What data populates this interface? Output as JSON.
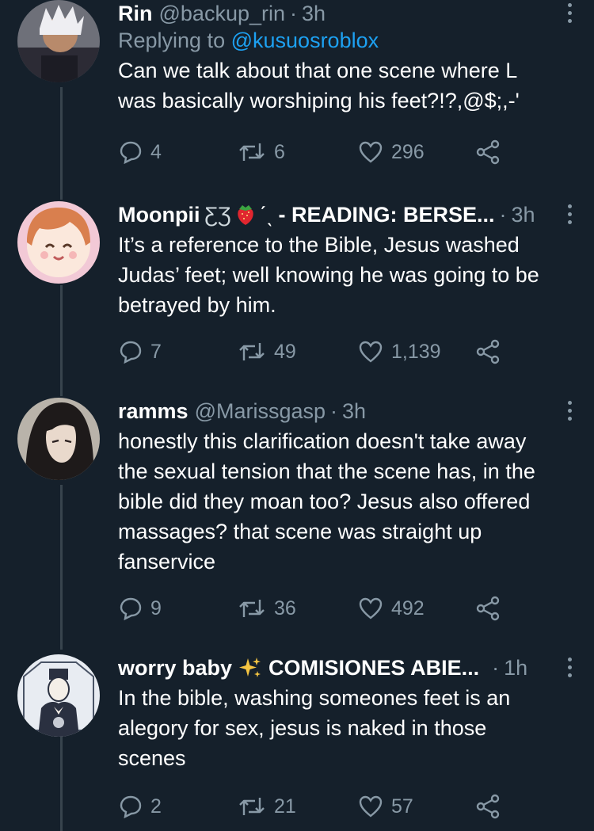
{
  "tweets": [
    {
      "name": "Rin",
      "handle": "@backup_rin",
      "time": "3h",
      "replying_label": "Replying to",
      "replying_to": "@kusuosroblox",
      "text": "Can we talk about that one scene where L\nwas basically worshiping his feet?!?,@$;,-'",
      "replies": "4",
      "retweets": "6",
      "likes": "296"
    },
    {
      "name": "Moonpii",
      "name_suffix": "- READING: BERSE...",
      "time": "3h",
      "text": "It’s a reference to the Bible, Jesus washed\nJudas’ feet; well knowing he was going to be\nbetrayed by him.",
      "replies": "7",
      "retweets": "49",
      "likes": "1,139"
    },
    {
      "name": "ramms",
      "handle": "@Marissgasp",
      "time": "3h",
      "text": "honestly this clarification doesn't take away\nthe sexual tension that the scene has, in the\nbible did they moan too? Jesus also offered\nmassages? that scene was straight up\nfanservice",
      "replies": "9",
      "retweets": "36",
      "likes": "492"
    },
    {
      "name": "worry baby",
      "name_suffix": "COMISIONES ABIE...",
      "time": "1h",
      "text": "In the bible, washing someones feet is an\nalegory for sex, jesus is naked in those\nscenes",
      "replies": "2",
      "retweets": "21",
      "likes": "57"
    }
  ],
  "icons": {
    "reply": "reply-icon",
    "retweet": "retweet-icon",
    "like": "heart-icon",
    "share": "share-icon",
    "more": "more-vertical-icon"
  },
  "colors": {
    "background": "#15202b",
    "text": "#ffffff",
    "secondary": "#8899a6",
    "link": "#1da1f2",
    "thread_line": "#38444d"
  }
}
